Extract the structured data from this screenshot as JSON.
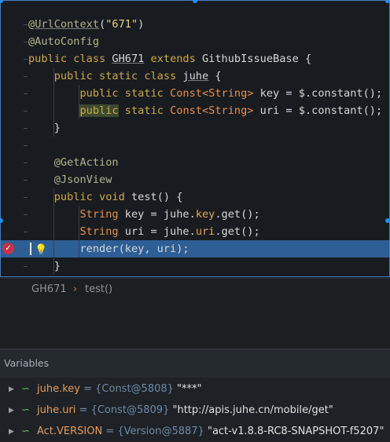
{
  "editor": {
    "lines": [
      {
        "id": "l1",
        "segments": [
          {
            "t": "@",
            "c": "ann"
          },
          {
            "t": "UrlContext",
            "c": "ann"
          },
          {
            "t": "(",
            "c": "pl"
          },
          {
            "t": "\"671\"",
            "c": "str"
          },
          {
            "t": ")",
            "c": "pl"
          }
        ]
      },
      {
        "id": "l2",
        "segments": [
          {
            "t": "@AutoConfig",
            "c": "ann"
          }
        ]
      },
      {
        "id": "l3",
        "segments": [
          {
            "t": "public class ",
            "c": "kw"
          },
          {
            "t": "GH671",
            "c": "pl"
          },
          {
            "t": " extends ",
            "c": "kw"
          },
          {
            "t": "GithubIssueBase",
            "c": "pl"
          },
          {
            "t": " {",
            "c": "pl"
          }
        ]
      },
      {
        "id": "l4",
        "segments": [
          {
            "t": "    public static class ",
            "c": "kw"
          },
          {
            "t": "juhe",
            "c": "pl"
          },
          {
            "t": " {",
            "c": "pl"
          }
        ]
      },
      {
        "id": "l5",
        "segments": [
          {
            "t": "        public static ",
            "c": "kw"
          },
          {
            "t": "Const<String>",
            "c": "ty"
          },
          {
            "t": " key = ",
            "c": "pl"
          },
          {
            "t": "$",
            "c": "pl"
          },
          {
            "t": ".constant();",
            "c": "pl"
          }
        ]
      },
      {
        "id": "l6",
        "segments": [
          {
            "t": "        ",
            "c": "pl"
          },
          {
            "t": "public",
            "c": "kw"
          },
          {
            "t": " static ",
            "c": "kw"
          },
          {
            "t": "Const<String>",
            "c": "ty"
          },
          {
            "t": " uri = ",
            "c": "pl"
          },
          {
            "t": "$",
            "c": "pl"
          },
          {
            "t": ".constant();",
            "c": "pl"
          }
        ]
      },
      {
        "id": "l7",
        "segments": [
          {
            "t": "    }",
            "c": "pl"
          }
        ]
      },
      {
        "id": "l8",
        "segments": []
      },
      {
        "id": "l9",
        "segments": [
          {
            "t": "    @GetAction",
            "c": "ann"
          }
        ]
      },
      {
        "id": "l10",
        "segments": [
          {
            "t": "    @JsonView",
            "c": "ann"
          }
        ]
      },
      {
        "id": "l11",
        "segments": [
          {
            "t": "    public void ",
            "c": "kw"
          },
          {
            "t": "test",
            "c": "pl"
          },
          {
            "t": "() {",
            "c": "pl"
          }
        ]
      },
      {
        "id": "l12",
        "segments": [
          {
            "t": "        String ",
            "c": "ty"
          },
          {
            "t": "key = ",
            "c": "pl"
          },
          {
            "t": "juhe",
            "c": "pl"
          },
          {
            "t": ".",
            "c": "pl"
          },
          {
            "t": "key",
            "c": "fd"
          },
          {
            "t": ".get();",
            "c": "pl"
          }
        ]
      },
      {
        "id": "l13",
        "segments": [
          {
            "t": "        String ",
            "c": "ty"
          },
          {
            "t": "uri = ",
            "c": "pl"
          },
          {
            "t": "juhe",
            "c": "pl"
          },
          {
            "t": ".",
            "c": "pl"
          },
          {
            "t": "uri",
            "c": "fd"
          },
          {
            "t": ".get();",
            "c": "pl"
          }
        ]
      },
      {
        "id": "l14",
        "segments": [
          {
            "t": "        render(key, uri);",
            "c": "pl"
          }
        ]
      },
      {
        "id": "l15",
        "segments": [
          {
            "t": "    }",
            "c": "pl"
          }
        ]
      }
    ]
  },
  "breadcrumb": {
    "class_name": "GH671",
    "separator": "›",
    "method": "test()"
  },
  "debugger": {
    "panel_title": "Variables",
    "variables": [
      {
        "name": "juhe.key",
        "ref": " = {Const@5808} ",
        "value": "\"***\""
      },
      {
        "name": "juhe.uri",
        "ref": " = {Const@5809} ",
        "value": "\"http://apis.juhe.cn/mobile/get\""
      },
      {
        "name": "Act.VERSION",
        "ref": " = {Version@5887} ",
        "value": "\"act-v1.8.8-RC8-SNAPSHOT-f5207\""
      }
    ]
  },
  "icons": {
    "breakpoint": "breakpoint-icon",
    "bulb": "lightbulb-icon",
    "expand": "expand-arrow-icon",
    "variable": "variable-icon"
  },
  "colors": {
    "current_line": "#2d5e95",
    "keyword": "#cfa84a",
    "type": "#e68f4e",
    "annotation": "#b3b38c",
    "breakpoint": "#c4334a"
  }
}
